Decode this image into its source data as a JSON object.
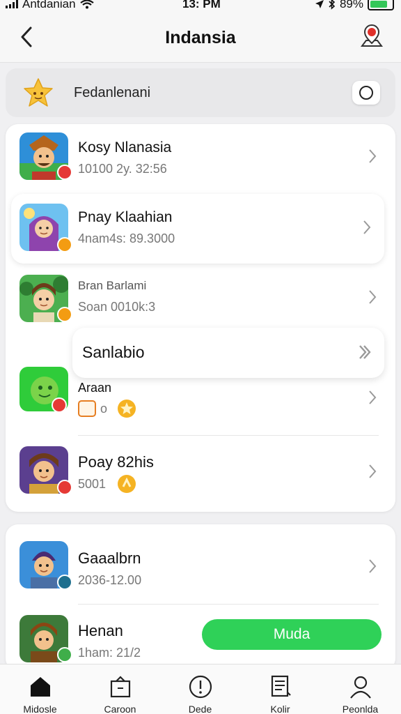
{
  "status_bar": {
    "carrier": "Antdanian",
    "time": "13: PM",
    "battery": "89%"
  },
  "header": {
    "title": "Indansia"
  },
  "banner": {
    "label": "Fedanlenani"
  },
  "list_a": [
    {
      "title": "Kosy Nlanasia",
      "subtitle": "10100 2y. 32:56"
    },
    {
      "title": "Pnay Klaahian",
      "subtitle": "4nam4s: 89.3000"
    },
    {
      "title": "Bran Barlami",
      "subtitle": "Soan 0010k:3"
    },
    {
      "title": "Sanlabio",
      "subtitle": ""
    },
    {
      "title": "Araan",
      "subtitle": "o"
    },
    {
      "title": "Poay 82his",
      "subtitle": "5001"
    }
  ],
  "list_b": [
    {
      "title": "Gaaalbrn",
      "subtitle": "2036-12.00"
    },
    {
      "title": "Henan",
      "subtitle": "1ham: 21/2"
    }
  ],
  "action_button": {
    "label": "Muda"
  },
  "tabs": [
    {
      "label": "Midosle",
      "icon": "home-icon"
    },
    {
      "label": "Caroon",
      "icon": "bag-icon"
    },
    {
      "label": "Dede",
      "icon": "alert-icon"
    },
    {
      "label": "Kolir",
      "icon": "list-icon"
    },
    {
      "label": "Peonlda",
      "icon": "person-icon"
    }
  ],
  "colors": {
    "accent_green": "#2fd158",
    "battery_green": "#34c759",
    "location_red": "#e0302a"
  }
}
